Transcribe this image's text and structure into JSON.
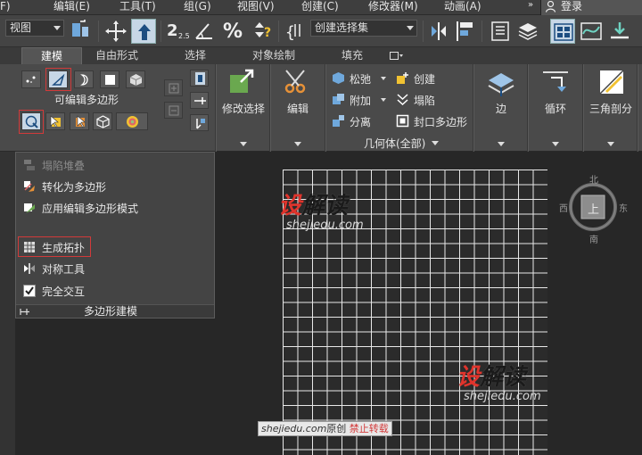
{
  "menubar": {
    "items": [
      "F)",
      "编辑(E)",
      "工具(T)",
      "组(G)",
      "视图(V)",
      "创建(C)",
      "修改器(M)",
      "动画(A)"
    ],
    "more": "»",
    "login": "登录"
  },
  "toolbar": {
    "view_combo": "视图",
    "selection_set_combo": "创建选择集",
    "snap_value": "2.5"
  },
  "ribbon": {
    "tabs": [
      "建模",
      "自由形式",
      "选择",
      "对象绘制",
      "填充"
    ],
    "active_tab": "建模",
    "poly_label": "可编辑多边形",
    "modify_select": "修改选择",
    "edit": "编辑",
    "geometry": {
      "relax": "松弛",
      "create": "创建",
      "attach": "附加",
      "collapse": "塌陷",
      "detach": "分离",
      "cap_poly": "封口多边形",
      "title": "几何体(全部)"
    },
    "edges": "边",
    "loops": "循环",
    "tris": "三角剖分"
  },
  "dropdown": {
    "items": [
      {
        "label": "塌陷堆叠",
        "disabled": true
      },
      {
        "label": "转化为多边形",
        "disabled": false
      },
      {
        "label": "应用编辑多边形模式",
        "disabled": false
      },
      {
        "label": "生成拓扑",
        "disabled": false
      },
      {
        "label": "对称工具",
        "disabled": false
      },
      {
        "label": "完全交互",
        "disabled": false
      }
    ],
    "footer": "多边形建模"
  },
  "viewcube": {
    "north": "北",
    "south": "南",
    "east": "东",
    "west": "西",
    "face": "上"
  },
  "watermark": {
    "logo_a": "设",
    "logo_b": "解读",
    "url": "shejiedu.com",
    "footer_url": "shejiedu.com",
    "footer_orig": "原创",
    "footer_warn": "禁止转载"
  },
  "colors": {
    "highlight_red": "#d23a3a",
    "logo_red": "#e0342c",
    "ribbon_bg": "#4a4a4a",
    "viewport_bg": "#272727"
  }
}
